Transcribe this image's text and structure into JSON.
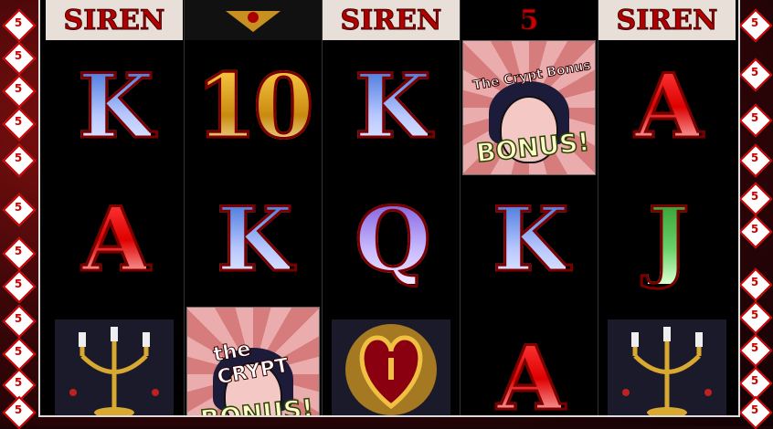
{
  "left_paylines": [
    "5",
    "5",
    "5",
    "5",
    "5",
    "5",
    "5",
    "5",
    "5",
    "5",
    "5",
    "5"
  ],
  "right_paylines": [
    "5",
    "5",
    "5",
    "5",
    "5",
    "5",
    "5",
    "5",
    "5",
    "5",
    "5"
  ],
  "reels": [
    {
      "top": "SIREN",
      "symbols": [
        "K",
        "A",
        "candelabra"
      ]
    },
    {
      "top": "",
      "symbols": [
        "10",
        "K",
        "The Crypt Bonus"
      ]
    },
    {
      "top": "SIREN",
      "symbols": [
        "K",
        "Q",
        "heart"
      ]
    },
    {
      "top": "5",
      "symbols": [
        "The Crypt Bonus",
        "K",
        "A"
      ]
    },
    {
      "top": "SIREN",
      "symbols": [
        "A",
        "J",
        "candelabra"
      ]
    }
  ],
  "bonus": {
    "line1": "the CRYPT",
    "line2": "BONUS!"
  },
  "colors": {
    "accent": "#cc0000",
    "frame": "#8a1010",
    "reel_bg": "#000000"
  }
}
